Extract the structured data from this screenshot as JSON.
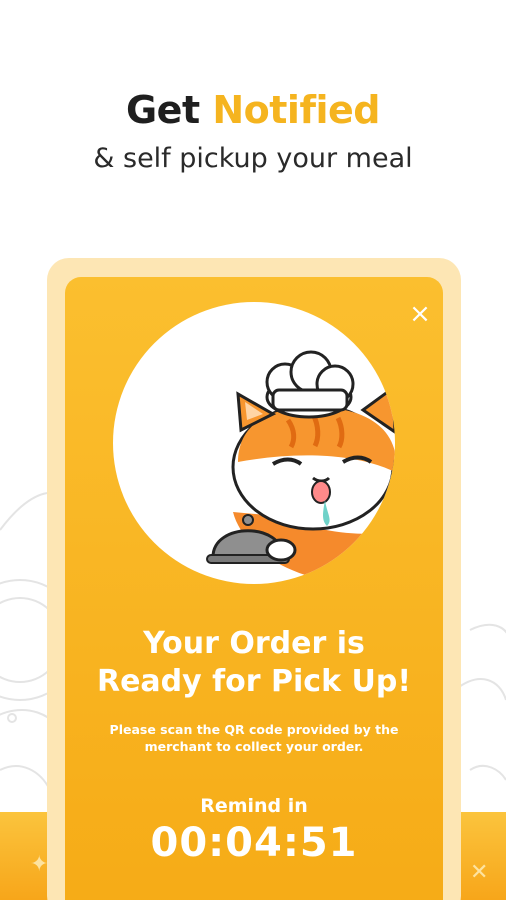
{
  "header": {
    "title_prefix": "Get",
    "title_accent": "Notified",
    "subtitle": "& self pickup your meal"
  },
  "colors": {
    "accent": "#f5b41f",
    "card_bg": "#f8b420",
    "frame_bg": "#fde6b4"
  },
  "card": {
    "close_icon": "×",
    "illustration": "chef-cat-with-cloche",
    "title_line1": "Your Order is",
    "title_line2": "Ready for Pick Up!",
    "description": "Please scan the QR code provided by the merchant to collect your order.",
    "remind_label": "Remind in",
    "countdown": "00:04:51"
  }
}
